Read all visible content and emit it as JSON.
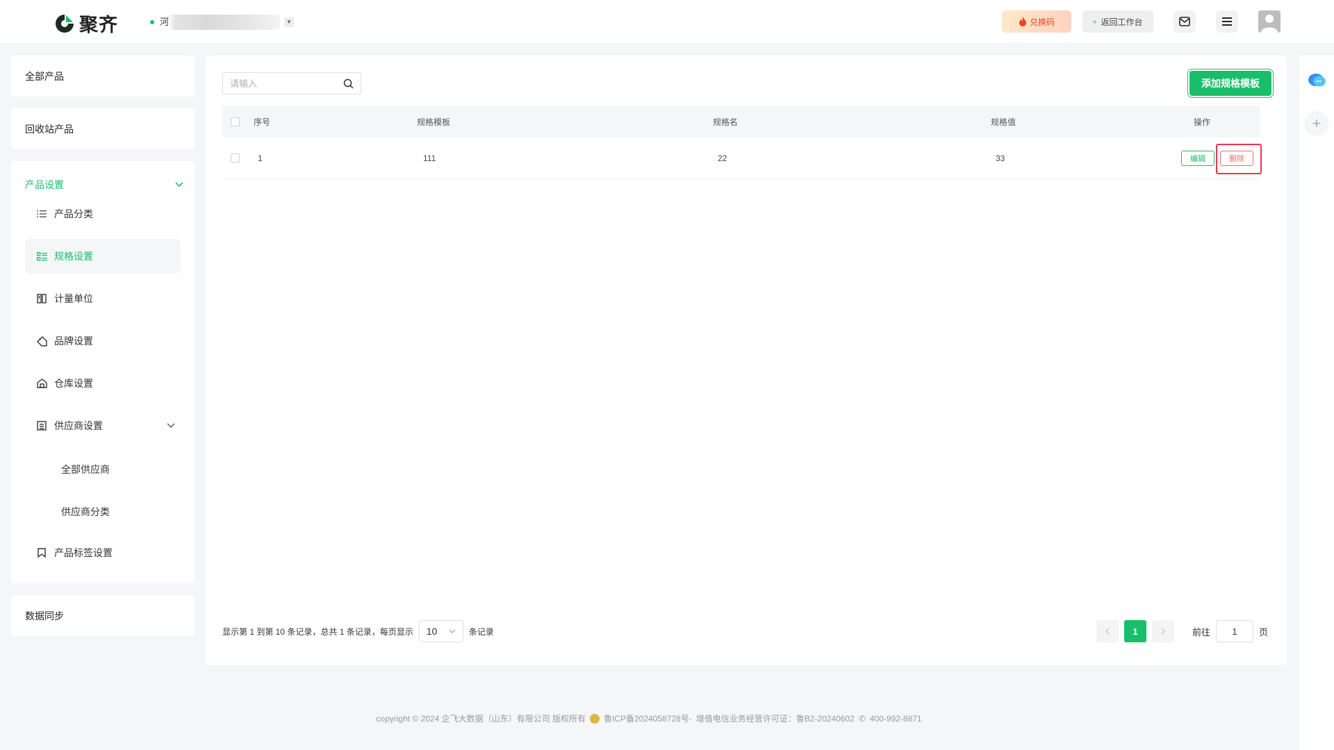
{
  "header": {
    "logo_text": "聚齐",
    "store_name": "河",
    "exchange_label": "兑换码",
    "back_label": "返回工作台"
  },
  "sidebar": {
    "all_products": "全部产品",
    "recycle_products": "回收站产品",
    "settings_group": "产品设置",
    "items": [
      {
        "label": "产品分类"
      },
      {
        "label": "规格设置"
      },
      {
        "label": "计量单位"
      },
      {
        "label": "品牌设置"
      },
      {
        "label": "仓库设置"
      },
      {
        "label": "供应商设置"
      }
    ],
    "supplier_sub": [
      {
        "label": "全部供应商"
      },
      {
        "label": "供应商分类"
      }
    ],
    "tag_settings": "产品标签设置",
    "data_sync": "数据同步"
  },
  "toolbar": {
    "search_placeholder": "请输入",
    "add_label": "添加规格模板"
  },
  "table": {
    "headers": {
      "index": "序号",
      "template": "规格模板",
      "spec_name": "规格名",
      "spec_value": "规格值",
      "actions": "操作"
    },
    "rows": [
      {
        "index": "1",
        "template": "111",
        "spec_name": "22",
        "spec_value": "33",
        "edit": "编辑",
        "delete": "删除"
      }
    ]
  },
  "pagination": {
    "summary": "显示第 1 到第 10 条记录，总共 1 条记录，每页显示",
    "page_size": "10",
    "records_suffix": "条记录",
    "current_page": "1",
    "goto_label": "前往",
    "goto_value": "1",
    "page_suffix": "页"
  },
  "footer": {
    "copyright": "copyright © 2024 企飞大数据（山东）有限公司 版权所有",
    "icp": "鲁ICP备2024058728号-",
    "license": "增值电信业务经营许可证：鲁B2-20240602",
    "phone": "400-992-8871"
  },
  "colors": {
    "accent": "#19be6b",
    "danger": "#f56c6c",
    "highlight_box": "#e8344e"
  }
}
